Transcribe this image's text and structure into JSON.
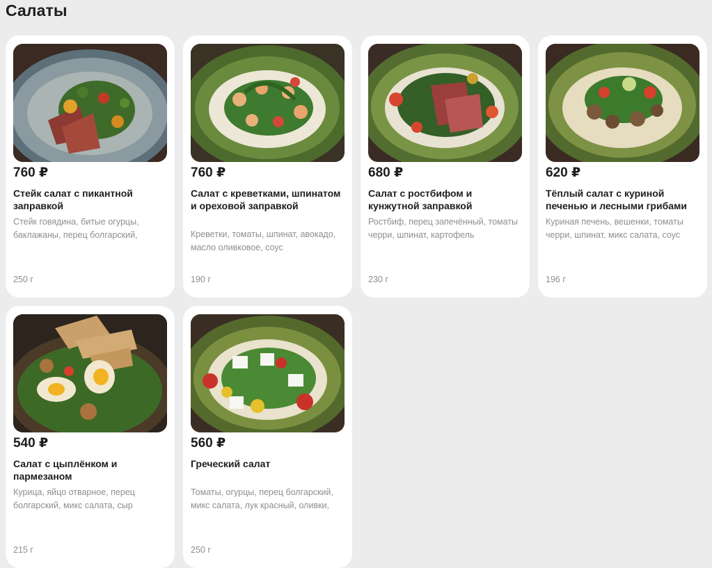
{
  "section": {
    "title": "Салаты"
  },
  "items": [
    {
      "price": "760 ₽",
      "name": "Стейк салат с пикантной заправкой",
      "ingredients": "Стейк говядина, битые огурцы, баклажаны, перец болгарский,",
      "weight": "250 г"
    },
    {
      "price": "760 ₽",
      "name": "Салат с креветками, шпинатом и ореховой заправкой",
      "ingredients": "Креветки, томаты, шпинат, авокадо, масло оливковое, соус",
      "weight": "190 г"
    },
    {
      "price": "680 ₽",
      "name": "Салат с ростбифом и кунжутной заправкой",
      "ingredients": "Ростбиф, перец запечённый, томаты черри, шпинат, картофель",
      "weight": "230 г"
    },
    {
      "price": "620 ₽",
      "name": "Тёплый салат с куриной печенью и лесными грибами",
      "ingredients": "Куриная печень, вешенки, томаты черри, шпинат, микс салата, соус",
      "weight": "196 г"
    },
    {
      "price": "540 ₽",
      "name": "Салат с цыплёнком и пармезаном",
      "ingredients": "Курица, яйцо отварное, перец болгарский, микс салата, сыр",
      "weight": "215 г"
    },
    {
      "price": "560 ₽",
      "name": "Греческий салат",
      "ingredients": "Томаты, огурцы, перец болгарский, микс салата, лук красный, оливки,",
      "weight": "250 г"
    }
  ]
}
